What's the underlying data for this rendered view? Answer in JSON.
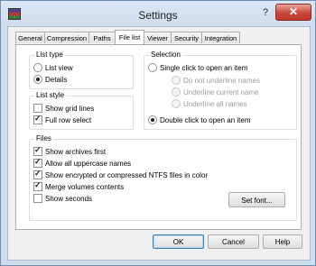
{
  "window": {
    "title": "Settings",
    "help": "?",
    "close": "✕"
  },
  "tabs": [
    "General",
    "Compression",
    "Paths",
    "File list",
    "Viewer",
    "Security",
    "Integration"
  ],
  "list_type": {
    "title": "List type",
    "options": [
      "List view",
      "Details"
    ],
    "selected": "Details"
  },
  "list_style": {
    "title": "List style",
    "options": [
      {
        "label": "Show grid lines",
        "checked": false
      },
      {
        "label": "Full row select",
        "checked": true
      }
    ]
  },
  "selection": {
    "title": "Selection",
    "single_click": "Single click to open an item",
    "sub_options": [
      "Do not underline names",
      "Underline current name",
      "Underline all names"
    ],
    "double_click": "Double click to open an item",
    "selected": "double"
  },
  "files": {
    "title": "Files",
    "options": [
      {
        "label": "Show archives first",
        "checked": true
      },
      {
        "label": "Allow all uppercase names",
        "checked": true
      },
      {
        "label": "Show encrypted or compressed NTFS files in color",
        "checked": true
      },
      {
        "label": "Merge volumes contents",
        "checked": true
      },
      {
        "label": "Show seconds",
        "checked": false
      }
    ],
    "set_font": "Set font..."
  },
  "buttons": {
    "ok": "OK",
    "cancel": "Cancel",
    "help": "Help"
  }
}
